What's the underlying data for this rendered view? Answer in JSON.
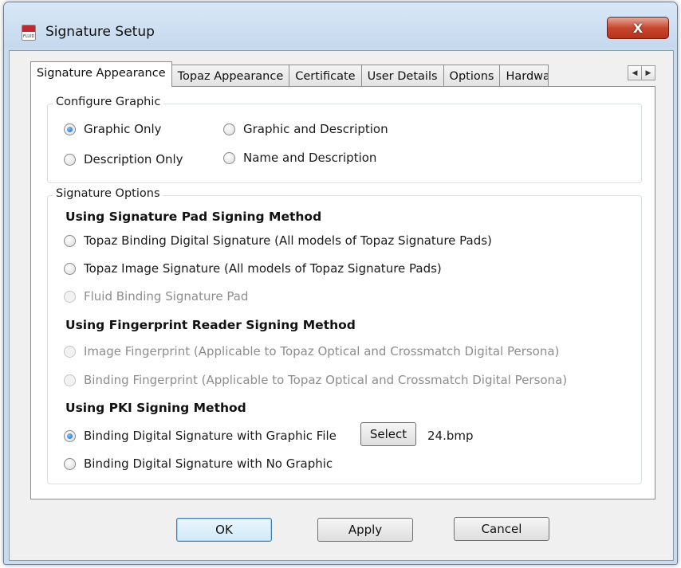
{
  "window": {
    "title": "Signature Setup",
    "icon_label": "FLUID",
    "close_glyph": "X"
  },
  "tabs": [
    {
      "label": "Signature Appearance",
      "active": true
    },
    {
      "label": "Topaz Appearance",
      "active": false
    },
    {
      "label": "Certificate",
      "active": false
    },
    {
      "label": "User Details",
      "active": false
    },
    {
      "label": "Options",
      "active": false
    },
    {
      "label": "Hardware",
      "active": false
    }
  ],
  "tab_scroll": {
    "left": "◀",
    "right": "▶"
  },
  "configure_graphic": {
    "title": "Configure Graphic",
    "options": [
      {
        "label": "Graphic Only",
        "selected": true
      },
      {
        "label": "Graphic and Description",
        "selected": false
      },
      {
        "label": "Description Only",
        "selected": false
      },
      {
        "label": "Name and Description",
        "selected": false
      }
    ]
  },
  "signature_options": {
    "title": "Signature Options",
    "pad_heading": "Using Signature Pad Signing Method",
    "pad_options": [
      {
        "label": "Topaz Binding Digital Signature (All models of Topaz Signature Pads)",
        "selected": false,
        "enabled": true
      },
      {
        "label": "Topaz Image Signature (All models of Topaz Signature Pads)",
        "selected": false,
        "enabled": true
      },
      {
        "label": "Fluid Binding Signature Pad",
        "selected": false,
        "enabled": false
      }
    ],
    "fingerprint_heading": "Using Fingerprint Reader Signing Method",
    "fingerprint_options": [
      {
        "label": "Image Fingerprint (Applicable to Topaz Optical and Crossmatch Digital Persona)",
        "selected": false,
        "enabled": false
      },
      {
        "label": "Binding Fingerprint (Applicable to Topaz Optical and Crossmatch Digital Persona)",
        "selected": false,
        "enabled": false
      }
    ],
    "pki_heading": "Using PKI Signing Method",
    "pki_options": [
      {
        "label": "Binding Digital Signature with Graphic File",
        "selected": true,
        "enabled": true
      },
      {
        "label": "Binding Digital Signature with No Graphic",
        "selected": false,
        "enabled": true
      }
    ],
    "select_button": "Select",
    "selected_file": "24.bmp"
  },
  "buttons": {
    "ok": "OK",
    "apply": "Apply",
    "cancel": "Cancel"
  },
  "colors": {
    "accent": "#1d63b0",
    "close_red": "#c8472f",
    "frame": "#c9dcee"
  }
}
